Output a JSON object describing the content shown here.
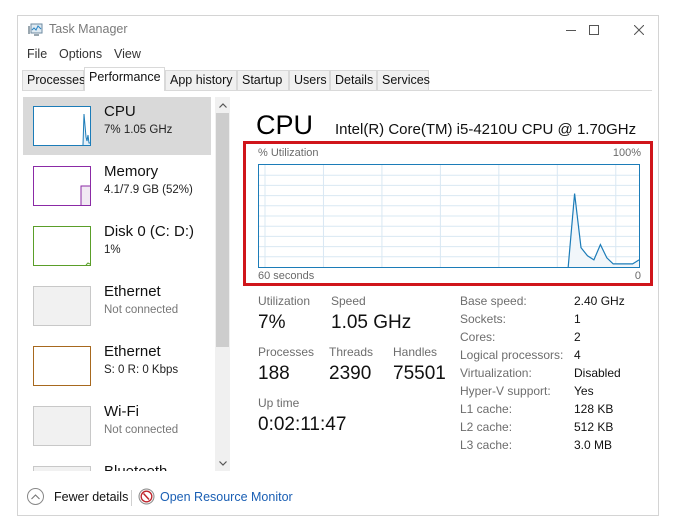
{
  "window": {
    "title": "Task Manager",
    "controls": {
      "minimize": "—",
      "maximize": "☐",
      "close": "✕"
    }
  },
  "menu": [
    "File",
    "Options",
    "View"
  ],
  "tabs": [
    {
      "label": "Processes",
      "active": false
    },
    {
      "label": "Performance",
      "active": true
    },
    {
      "label": "App history",
      "active": false
    },
    {
      "label": "Startup",
      "active": false
    },
    {
      "label": "Users",
      "active": false
    },
    {
      "label": "Details",
      "active": false
    },
    {
      "label": "Services",
      "active": false
    }
  ],
  "sidebar": {
    "items": [
      {
        "title": "CPU",
        "subtitle": "7% 1.05 GHz",
        "color": "#1c7cb8",
        "selected": true
      },
      {
        "title": "Memory",
        "subtitle": "4.1/7.9 GB (52%)",
        "color": "#8b2aa6",
        "selected": false
      },
      {
        "title": "Disk 0 (C: D:)",
        "subtitle": "1%",
        "color": "#5a9e29",
        "selected": false
      },
      {
        "title": "Ethernet",
        "subtitle": "Not connected",
        "color": "#c8c8c8",
        "selected": false
      },
      {
        "title": "Ethernet",
        "subtitle": "S: 0 R: 0 Kbps",
        "color": "#a7681e",
        "selected": false
      },
      {
        "title": "Wi-Fi",
        "subtitle": "Not connected",
        "color": "#c8c8c8",
        "selected": false
      },
      {
        "title": "Bluetooth",
        "subtitle": "",
        "color": "#c8c8c8",
        "selected": false
      }
    ],
    "scroll_up": "˄",
    "scroll_down": "˅"
  },
  "main": {
    "title": "CPU",
    "model": "Intel(R) Core(TM) i5-4210U CPU @ 1.70GHz",
    "graph": {
      "label_left": "% Utilization",
      "label_right": "100%",
      "foot_left": "60 seconds",
      "foot_right": "0"
    },
    "stats": {
      "utilization_label": "Utilization",
      "utilization_value": "7%",
      "speed_label": "Speed",
      "speed_value": "1.05 GHz",
      "processes_label": "Processes",
      "processes_value": "188",
      "threads_label": "Threads",
      "threads_value": "2390",
      "handles_label": "Handles",
      "handles_value": "75501",
      "uptime_label": "Up time",
      "uptime_value": "0:02:11:47"
    },
    "specs": [
      {
        "label": "Base speed:",
        "value": "2.40 GHz"
      },
      {
        "label": "Sockets:",
        "value": "1"
      },
      {
        "label": "Cores:",
        "value": "2"
      },
      {
        "label": "Logical processors:",
        "value": "4"
      },
      {
        "label": "Virtualization:",
        "value": "Disabled"
      },
      {
        "label": "Hyper-V support:",
        "value": "Yes"
      },
      {
        "label": "L1 cache:",
        "value": "128 KB"
      },
      {
        "label": "L2 cache:",
        "value": "512 KB"
      },
      {
        "label": "L3 cache:",
        "value": "3.0 MB"
      }
    ]
  },
  "footer": {
    "fewer_details": "Fewer details",
    "resource_monitor": "Open Resource Monitor"
  },
  "colors": {
    "cpu_accent": "#1c7cb8",
    "graph_fill": "#f1f6fa",
    "grid": "#d9e8f3",
    "highlight": "#d0151b",
    "link": "#1a5fb4"
  },
  "chart_data": {
    "type": "area",
    "title": "% Utilization",
    "xlabel": "60 seconds",
    "ylabel": "% Utilization",
    "xlim": [
      60,
      0
    ],
    "ylim": [
      0,
      100
    ],
    "x_unit": "seconds ago",
    "grid": true,
    "y_label_max": "100%",
    "x_label_end": "0",
    "samples_oldest_to_newest": [
      0,
      0,
      0,
      0,
      0,
      0,
      0,
      0,
      0,
      0,
      0,
      0,
      0,
      0,
      0,
      0,
      0,
      0,
      0,
      0,
      0,
      0,
      0,
      0,
      0,
      0,
      0,
      0,
      0,
      0,
      0,
      0,
      0,
      0,
      0,
      0,
      0,
      0,
      0,
      0,
      0,
      0,
      0,
      0,
      0,
      0,
      0,
      0,
      0,
      72,
      19,
      11,
      7,
      22,
      9,
      3,
      3,
      3,
      3,
      7
    ]
  }
}
